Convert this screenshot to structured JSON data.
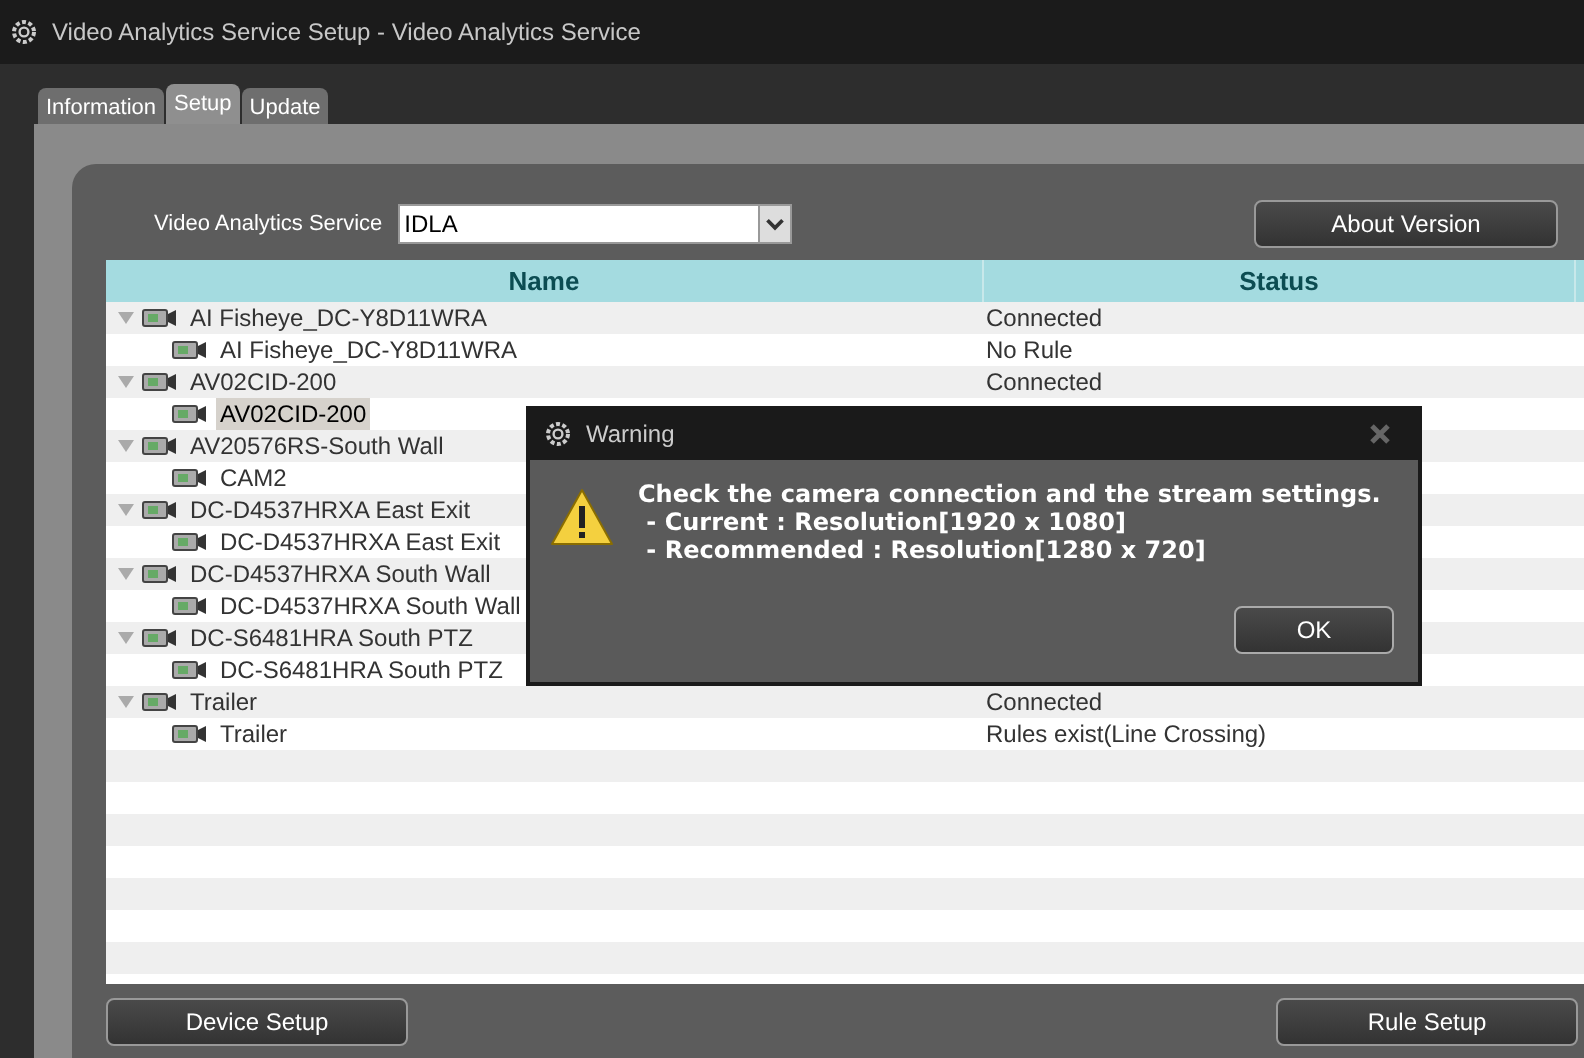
{
  "window": {
    "title": "Video Analytics Service Setup - Video Analytics Service"
  },
  "tabs": [
    {
      "label": "Information",
      "selected": false
    },
    {
      "label": "Setup",
      "selected": true
    },
    {
      "label": "Update",
      "selected": false
    }
  ],
  "service": {
    "label": "Video Analytics Service",
    "value": "IDLA"
  },
  "about_button": "About Version",
  "table": {
    "columns": [
      "Name",
      "Status"
    ],
    "devices": [
      {
        "name": "AI Fisheye_DC-Y8D11WRA",
        "status": "Connected",
        "expanded": true,
        "children": [
          {
            "name": "AI Fisheye_DC-Y8D11WRA",
            "status": "No Rule",
            "selected": false
          }
        ]
      },
      {
        "name": "AV02CID-200",
        "status": "Connected",
        "expanded": true,
        "children": [
          {
            "name": "AV02CID-200",
            "selected": true
          }
        ]
      },
      {
        "name": "AV20576RS-South Wall",
        "expanded": true,
        "children": [
          {
            "name": "CAM2",
            "selected": false
          }
        ]
      },
      {
        "name": "DC-D4537HRXA East Exit",
        "expanded": true,
        "children": [
          {
            "name": "DC-D4537HRXA East Exit",
            "selected": false
          }
        ]
      },
      {
        "name": "DC-D4537HRXA South Wall",
        "expanded": true,
        "children": [
          {
            "name": "DC-D4537HRXA South Wall",
            "selected": false
          }
        ]
      },
      {
        "name": "DC-S6481HRA South PTZ",
        "expanded": true,
        "children": [
          {
            "name": "DC-S6481HRA South PTZ",
            "selected": false
          }
        ]
      },
      {
        "name": "Trailer",
        "status": "Connected",
        "expanded": true,
        "children": [
          {
            "name": "Trailer",
            "status": "Rules exist(Line Crossing)",
            "selected": false
          }
        ]
      }
    ]
  },
  "buttons": [
    "Device Setup",
    "Rule Setup"
  ],
  "dialog": {
    "title": "Warning",
    "message": [
      "Check the camera connection and the stream settings.",
      " - Current : Resolution[1920 x 1080]",
      " - Recommended : Resolution[1280 x 720]"
    ],
    "button": "OK"
  }
}
